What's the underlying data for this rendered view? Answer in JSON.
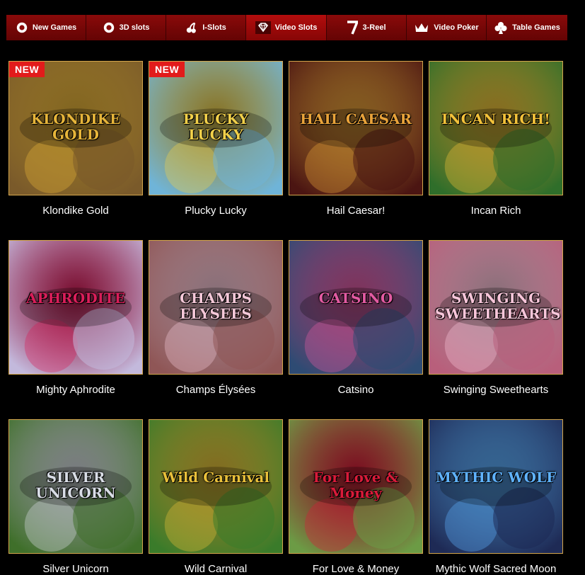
{
  "nav": [
    {
      "label": "New Games",
      "icon": "poker-chip-icon",
      "active": false
    },
    {
      "label": "3D slots",
      "icon": "poker-chip-icon",
      "active": false
    },
    {
      "label": "I-Slots",
      "icon": "cherry-icon",
      "active": false
    },
    {
      "label": "Video Slots",
      "icon": "diamond-icon",
      "active": true
    },
    {
      "label": "3-Reel",
      "icon": "seven-icon",
      "active": false
    },
    {
      "label": "Video Poker",
      "icon": "crown-icon",
      "active": false
    },
    {
      "label": "Table Games",
      "icon": "club-icon",
      "active": false
    }
  ],
  "badge_new": "NEW",
  "games": [
    {
      "title": "Klondike Gold",
      "art_text": "KLONDIKE GOLD",
      "new": true,
      "bg": "#7a5a2a",
      "accent": "#e7b53a"
    },
    {
      "title": "Plucky Lucky",
      "art_text": "PLUCKY LUCKY",
      "new": true,
      "bg": "#6fb4d8",
      "accent": "#f1d04a"
    },
    {
      "title": "Hail Caesar!",
      "art_text": "HAIL CAESAR",
      "new": false,
      "bg": "#4b1512",
      "accent": "#e9a33a"
    },
    {
      "title": "Incan Rich",
      "art_text": "INCAN RICH!",
      "new": false,
      "bg": "#2f6e2a",
      "accent": "#f3c23a"
    },
    {
      "title": "Mighty Aphrodite",
      "art_text": "APHRODITE",
      "new": false,
      "bg": "#c3b9dc",
      "accent": "#d91e5a"
    },
    {
      "title": "Champs Élysées",
      "art_text": "CHAMPS ELYSEES",
      "new": false,
      "bg": "#8f5656",
      "accent": "#f4c8d8"
    },
    {
      "title": "Catsino",
      "art_text": "CATSINO",
      "new": false,
      "bg": "#2e4b73",
      "accent": "#e35ba3"
    },
    {
      "title": "Swinging Sweethearts",
      "art_text": "SWINGING SWEETHEARTS",
      "new": false,
      "bg": "#b85f7b",
      "accent": "#f8c6da"
    },
    {
      "title": "Silver Unicorn",
      "art_text": "SILVER UNICORN",
      "new": false,
      "bg": "#3f6f2a",
      "accent": "#d9dde6"
    },
    {
      "title": "Wild Carnival",
      "art_text": "Wild Carnival",
      "new": false,
      "bg": "#3a7b2a",
      "accent": "#e9c03a"
    },
    {
      "title": "For Love & Money",
      "art_text": "For Love & Money",
      "new": false,
      "bg": "#6c9b45",
      "accent": "#d91b3a"
    },
    {
      "title": "Mythic Wolf Sacred Moon",
      "art_text": "MYTHIC WOLF",
      "new": false,
      "bg": "#1e2a55",
      "accent": "#5fb2ff"
    }
  ]
}
